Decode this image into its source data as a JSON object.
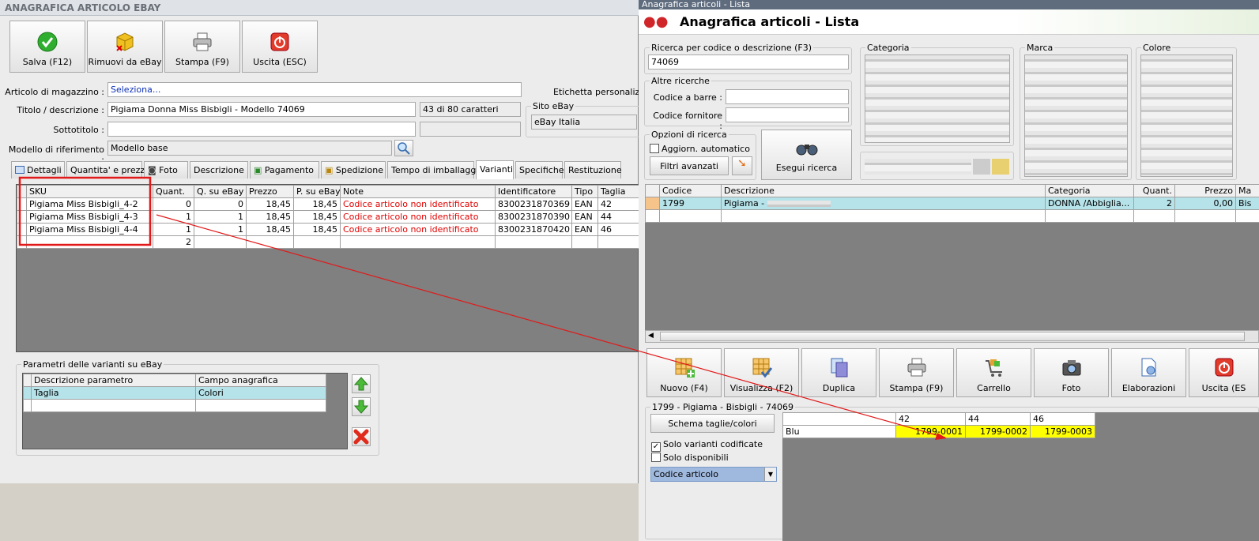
{
  "left_window": {
    "title": "ANAGRAFICA ARTICOLO EBAY",
    "toolbar": {
      "save": "Salva (F12)",
      "remove": "Rimuovi da eBay",
      "print": "Stampa (F9)",
      "exit": "Uscita (ESC)"
    },
    "form": {
      "articolo_label": "Articolo di magazzino :",
      "articolo_value": "Seleziona...",
      "etichetta_label": "Etichetta personalizzat",
      "titolo_label": "Titolo / descrizione :",
      "titolo_value": "Pigiama Donna Miss Bisbigli - Modello 74069",
      "char_count": "43 di 80 caratteri",
      "sito_label": "Sito eBay",
      "sito_value": "eBay Italia",
      "sottotitolo_label": "Sottotitolo :",
      "modello_label": "Modello di riferimento :",
      "modello_value": "Modello base"
    },
    "tabs": [
      "Dettagli",
      "Quantita' e prezzo",
      "Foto",
      "Descrizione",
      "Pagamento",
      "Spedizione",
      "Tempo di imballaggio",
      "Varianti",
      "Specifiche",
      "Restituzione"
    ],
    "grid": {
      "headers": [
        "SKU",
        "Quant.",
        "Q. su eBay",
        "Prezzo",
        "P. su eBay",
        "Note",
        "Identificatore",
        "Tipo",
        "Taglia"
      ],
      "rows": [
        [
          "Pigiama Miss Bisbigli_4-2",
          "0",
          "0",
          "18,45",
          "18,45",
          "Codice articolo non identificato",
          "8300231870369",
          "EAN",
          "42"
        ],
        [
          "Pigiama Miss Bisbigli_4-3",
          "1",
          "1",
          "18,45",
          "18,45",
          "Codice articolo non identificato",
          "8300231870390",
          "EAN",
          "44"
        ],
        [
          "Pigiama Miss Bisbigli_4-4",
          "1",
          "1",
          "18,45",
          "18,45",
          "Codice articolo non identificato",
          "8300231870420",
          "EAN",
          "46"
        ]
      ],
      "total": "2"
    },
    "params": {
      "title": "Parametri delle varianti su eBay",
      "headers": [
        "Descrizione parametro",
        "Campo anagrafica"
      ],
      "row": [
        "Taglia",
        "Colori"
      ]
    }
  },
  "right_window": {
    "titlebar": "Anagrafica articoli - Lista",
    "header": "Anagrafica articoli  - Lista",
    "search": {
      "label": "Ricerca per codice o descrizione (F3)",
      "value": "74069"
    },
    "altre": {
      "title": "Altre ricerche",
      "barcode": "Codice a barre :",
      "fornitore": "Codice fornitore :"
    },
    "opzioni": {
      "title": "Opzioni di ricerca",
      "auto": "Aggiorn. automatico",
      "filtri": "Filtri avanzati"
    },
    "esegui": "Esegui ricerca",
    "filters": [
      "Categoria",
      "Marca",
      "Colore"
    ],
    "grid": {
      "headers": [
        "Codice",
        "Descrizione",
        "Categoria",
        "Quant.",
        "Prezzo",
        "Ma"
      ],
      "row": [
        "1799",
        "Pigiama -",
        "DONNA /Abbiglia...",
        "2",
        "0,00",
        "Bis"
      ]
    },
    "toolbar": [
      "Nuovo (F4)",
      "Visualizza (F2)",
      "Duplica",
      "Stampa (F9)",
      "Carrello",
      "Foto",
      "Elaborazioni",
      "Uscita (ES"
    ],
    "variants": {
      "title": "1799 - Pigiama - Bisbigli - 74069",
      "schema": "Schema taglie/colori",
      "solo_cod": "Solo varianti codificate",
      "solo_disp": "Solo disponibili",
      "combo": "Codice articolo",
      "sizes": [
        "42",
        "44",
        "46"
      ],
      "color": "Blu",
      "codes": [
        "1799-0001",
        "1799-0002",
        "1799-0003"
      ]
    }
  },
  "colors": {
    "highlight": "#b6e3e9",
    "code_yellow": "#ffff00",
    "annotation_red": "#e11919"
  }
}
